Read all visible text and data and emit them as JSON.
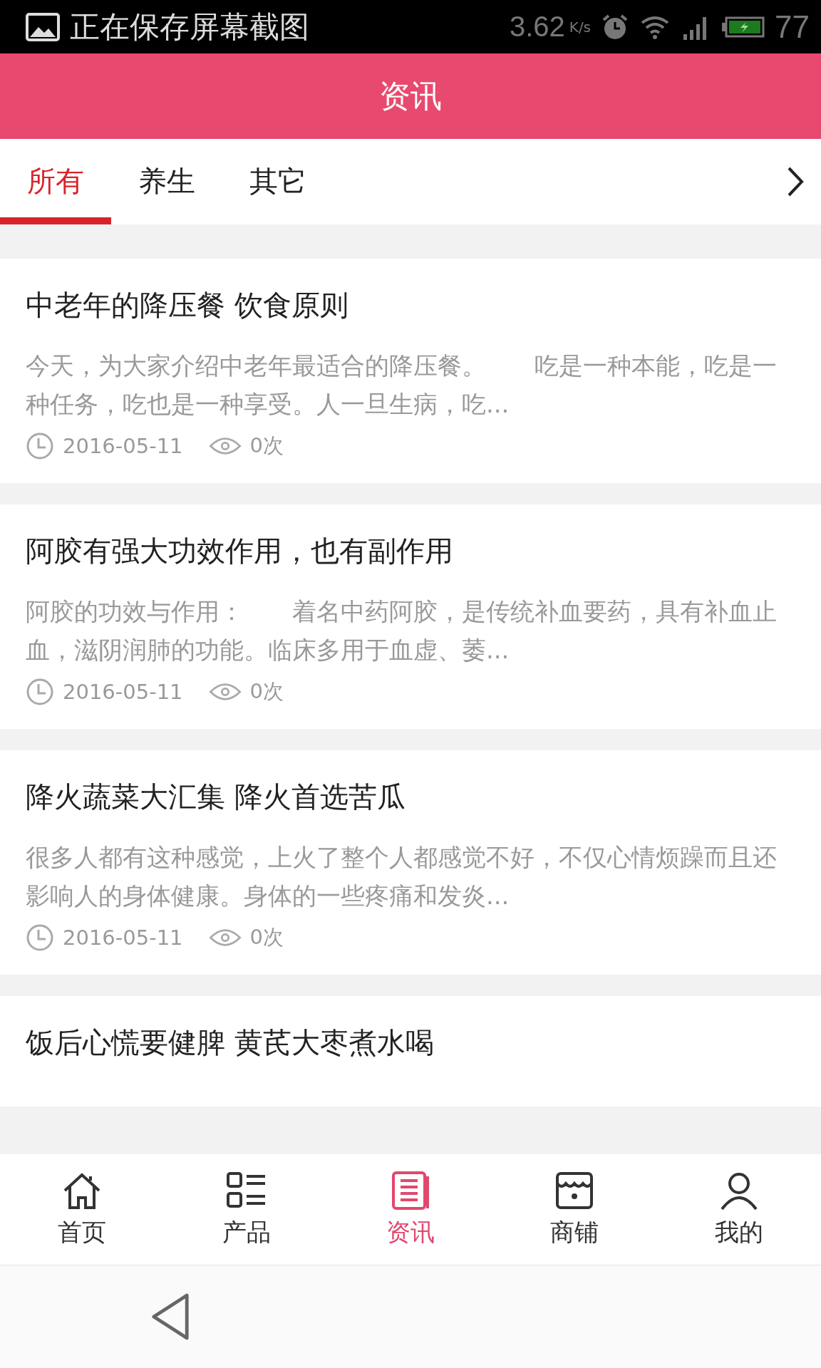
{
  "status_bar": {
    "notification": "正在保存屏幕截图",
    "speed": "3.62",
    "speed_unit": "K/s",
    "battery": "77"
  },
  "header": {
    "title": "资讯"
  },
  "tabs": [
    {
      "label": "所有",
      "selected": true
    },
    {
      "label": "养生",
      "selected": false
    },
    {
      "label": "其它",
      "selected": false
    }
  ],
  "articles": [
    {
      "title": "中老年的降压餐 饮食原则",
      "summary": "今天，为大家介绍中老年最适合的降压餐。　　吃是一种本能，吃是一种任务，吃也是一种享受。人一旦生病，吃...",
      "date": "2016-05-11",
      "views": "0次"
    },
    {
      "title": "阿胶有强大功效作用，也有副作用",
      "summary": "阿胶的功效与作用：　　着名中药阿胶，是传统补血要药，具有补血止血，滋阴润肺的功能。临床多用于血虚、萎...",
      "date": "2016-05-11",
      "views": "0次"
    },
    {
      "title": "降火蔬菜大汇集 降火首选苦瓜",
      "summary": "很多人都有这种感觉，上火了整个人都感觉不好，不仅心情烦躁而且还影响人的身体健康。身体的一些疼痛和发炎...",
      "date": "2016-05-11",
      "views": "0次"
    },
    {
      "title": "饭后心慌要健脾 黄芪大枣煮水喝"
    }
  ],
  "bottom_nav": [
    {
      "kind": "home",
      "label": "首页",
      "selected": false
    },
    {
      "kind": "products",
      "label": "产品",
      "selected": false
    },
    {
      "kind": "news",
      "label": "资讯",
      "selected": true
    },
    {
      "kind": "shop",
      "label": "商铺",
      "selected": false
    },
    {
      "kind": "profile",
      "label": "我的",
      "selected": false
    }
  ]
}
